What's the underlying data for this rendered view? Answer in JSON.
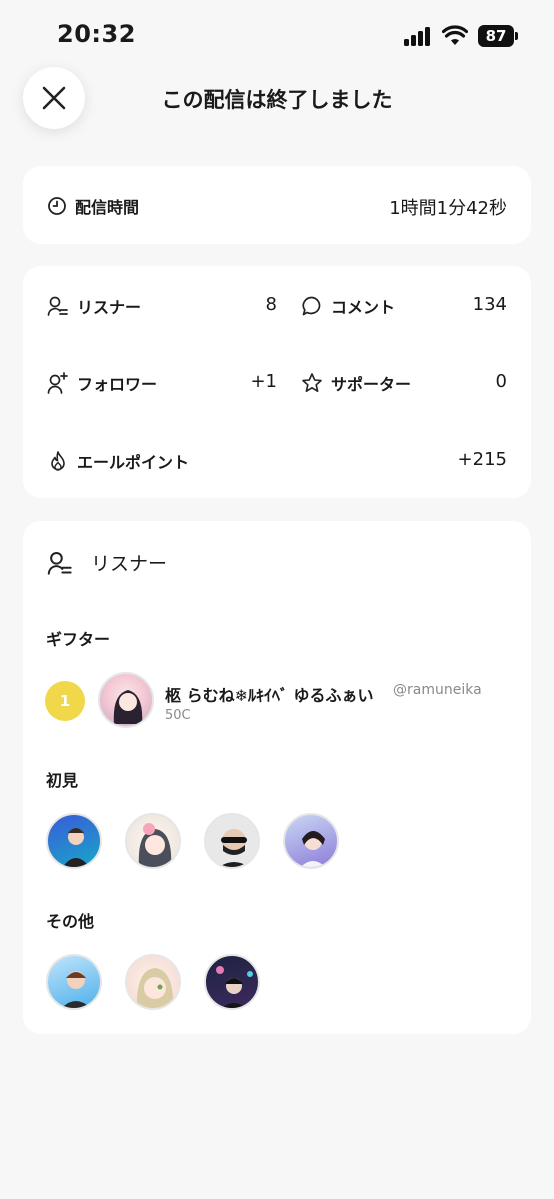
{
  "status_bar": {
    "time": "20:32",
    "battery": "87"
  },
  "header": {
    "title": "この配信は終了しました"
  },
  "duration": {
    "label": "配信時間",
    "value": "1時間1分42秒"
  },
  "stats": {
    "listeners": {
      "label": "リスナー",
      "value": "8"
    },
    "comments": {
      "label": "コメント",
      "value": "134"
    },
    "followers": {
      "label": "フォロワー",
      "value": "+1"
    },
    "supporters": {
      "label": "サポーター",
      "value": "0"
    },
    "yell_points": {
      "label": "エールポイント",
      "value": "+215"
    }
  },
  "listeners_section": {
    "title": "リスナー",
    "gifter_heading": "ギフター",
    "gifter": {
      "rank": "1",
      "name": "柩 らむね❄︎ﾙｷｲﾍﾞ ゆるふぁい",
      "handle": "@ramuneika",
      "amount": "50C"
    },
    "first_time_heading": "初見",
    "others_heading": "その他"
  },
  "colors": {
    "background": "#f7f7f7",
    "card": "#ffffff",
    "badge": "#f0d84a",
    "muted": "#8a8a8a"
  }
}
